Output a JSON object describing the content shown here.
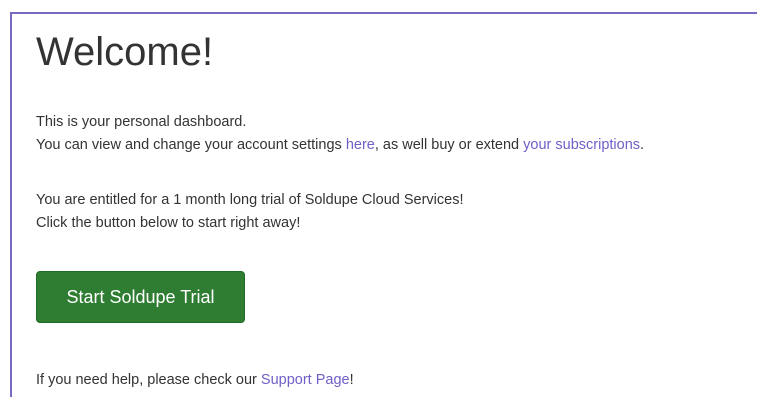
{
  "welcome": {
    "title": "Welcome!",
    "intro_line1": "This is your personal dashboard.",
    "intro_line2_prefix": "You can view and change your account settings ",
    "settings_link": "here",
    "intro_line2_middle": ", as well buy or extend ",
    "subscriptions_link": "your subscriptions",
    "intro_line2_suffix": ".",
    "trial_line1": "You are entitled for a 1 month long trial of Soldupe Cloud Services!",
    "trial_line2": "Click the button below to start right away!",
    "trial_button_label": "Start Soldupe Trial",
    "help_prefix": "If you need help, please check our ",
    "support_link": "Support Page",
    "help_suffix": "!"
  },
  "colors": {
    "border": "#7b68c2",
    "link": "#6f5fc6",
    "button": "#2e7d32",
    "text": "#333333"
  }
}
